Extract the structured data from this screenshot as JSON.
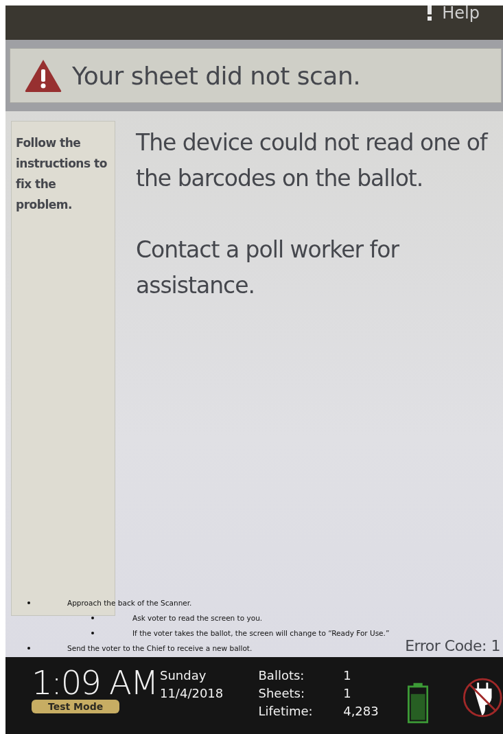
{
  "top_bar": {
    "help_label": "Help"
  },
  "banner": {
    "title": "Your sheet did not scan."
  },
  "sidebar": {
    "text": "Follow the instructions to fix the problem."
  },
  "messages": [
    "The device could not read one of the barcodes on the ballot.",
    "Contact a poll worker for assistance."
  ],
  "instructions": [
    {
      "text": "Approach the back of the Scanner.",
      "children": [
        {
          "text": "Ask voter to read the screen to you."
        },
        {
          "text": "If the voter takes the ballot, the screen will change to “Ready For Use.”"
        }
      ]
    },
    {
      "text": "Send the voter to the Chief to receive a new ballot."
    }
  ],
  "error_code": "Error Code: 1",
  "status_bar": {
    "time": "1:09 AM",
    "mode": "Test Mode",
    "day": "Sunday",
    "date": "11/4/2018",
    "counters": [
      {
        "label": "Ballots:",
        "value": "1"
      },
      {
        "label": "Sheets:",
        "value": "1"
      },
      {
        "label": "Lifetime:",
        "value": "4,283"
      }
    ]
  }
}
